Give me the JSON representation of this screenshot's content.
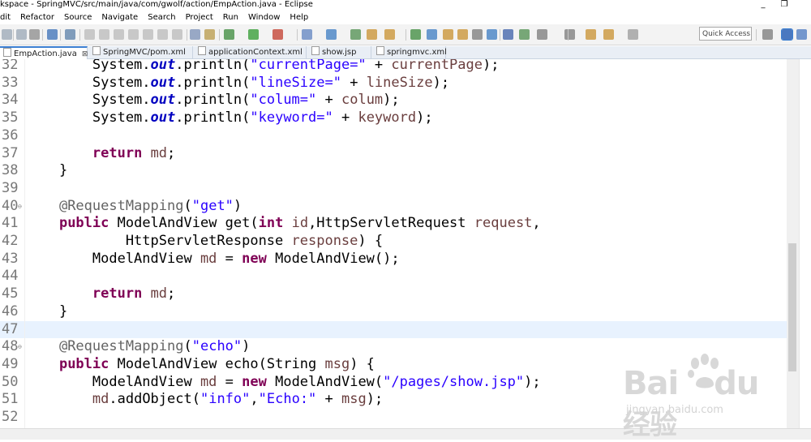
{
  "window": {
    "title": "kspace - SpringMVC/src/main/java/com/gwolf/action/EmpAction.java - Eclipse",
    "minimize": "_",
    "restore": "❐"
  },
  "menu": [
    "dit",
    "Refactor",
    "Source",
    "Navigate",
    "Search",
    "Project",
    "Run",
    "Window",
    "Help"
  ],
  "toolbar": {
    "quick_access": "Quick Access",
    "accent": "#3c7fd1"
  },
  "tabs": [
    {
      "label": "EmpAction.java",
      "active": true,
      "close": "⊠"
    },
    {
      "label": "SpringMVC/pom.xml",
      "active": false
    },
    {
      "label": "applicationContext.xml",
      "active": false
    },
    {
      "label": "show.jsp",
      "active": false
    },
    {
      "label": "springmvc.xml",
      "active": false
    }
  ],
  "editor": {
    "current_line": 47,
    "lines": [
      {
        "n": "32",
        "fold": false,
        "tokens": [
          [
            "",
            "        System."
          ],
          [
            "fld",
            "out"
          ],
          [
            "",
            ".println("
          ],
          [
            "st",
            "\"currentPage=\""
          ],
          [
            "",
            " + "
          ],
          [
            "vr",
            "currentPage"
          ],
          [
            "",
            ");"
          ]
        ]
      },
      {
        "n": "33",
        "fold": false,
        "tokens": [
          [
            "",
            "        System."
          ],
          [
            "fld",
            "out"
          ],
          [
            "",
            ".println("
          ],
          [
            "st",
            "\"lineSize=\""
          ],
          [
            "",
            " + "
          ],
          [
            "vr",
            "lineSize"
          ],
          [
            "",
            ");"
          ]
        ]
      },
      {
        "n": "34",
        "fold": false,
        "tokens": [
          [
            "",
            "        System."
          ],
          [
            "fld",
            "out"
          ],
          [
            "",
            ".println("
          ],
          [
            "st",
            "\"colum=\""
          ],
          [
            "",
            " + "
          ],
          [
            "vr",
            "colum"
          ],
          [
            "",
            ");"
          ]
        ]
      },
      {
        "n": "35",
        "fold": false,
        "tokens": [
          [
            "",
            "        System."
          ],
          [
            "fld",
            "out"
          ],
          [
            "",
            ".println("
          ],
          [
            "st",
            "\"keyword=\""
          ],
          [
            "",
            " + "
          ],
          [
            "vr",
            "keyword"
          ],
          [
            "",
            ");"
          ]
        ]
      },
      {
        "n": "36",
        "fold": false,
        "tokens": []
      },
      {
        "n": "37",
        "fold": false,
        "tokens": [
          [
            "",
            "        "
          ],
          [
            "kw",
            "return"
          ],
          [
            "",
            " "
          ],
          [
            "vr",
            "md"
          ],
          [
            "",
            ";"
          ]
        ]
      },
      {
        "n": "38",
        "fold": false,
        "tokens": [
          [
            "",
            "    }"
          ]
        ]
      },
      {
        "n": "39",
        "fold": false,
        "tokens": []
      },
      {
        "n": "40",
        "fold": true,
        "tokens": [
          [
            "",
            "    "
          ],
          [
            "an",
            "@RequestMapping"
          ],
          [
            "",
            "("
          ],
          [
            "st",
            "\"get\""
          ],
          [
            "",
            ")"
          ]
        ]
      },
      {
        "n": "41",
        "fold": false,
        "tokens": [
          [
            "",
            "    "
          ],
          [
            "kw",
            "public"
          ],
          [
            "",
            " ModelAndView get("
          ],
          [
            "kw",
            "int"
          ],
          [
            "",
            " "
          ],
          [
            "vr",
            "id"
          ],
          [
            "",
            ",HttpServletRequest "
          ],
          [
            "vr",
            "request"
          ],
          [
            "",
            ","
          ]
        ]
      },
      {
        "n": "42",
        "fold": false,
        "tokens": [
          [
            "",
            "            HttpServletResponse "
          ],
          [
            "vr",
            "response"
          ],
          [
            "",
            ") {"
          ]
        ]
      },
      {
        "n": "43",
        "fold": false,
        "tokens": [
          [
            "",
            "        ModelAndView "
          ],
          [
            "vr",
            "md"
          ],
          [
            "",
            " = "
          ],
          [
            "kw",
            "new"
          ],
          [
            "",
            " ModelAndView();"
          ]
        ]
      },
      {
        "n": "44",
        "fold": false,
        "tokens": []
      },
      {
        "n": "45",
        "fold": false,
        "tokens": [
          [
            "",
            "        "
          ],
          [
            "kw",
            "return"
          ],
          [
            "",
            " "
          ],
          [
            "vr",
            "md"
          ],
          [
            "",
            ";"
          ]
        ]
      },
      {
        "n": "46",
        "fold": false,
        "tokens": [
          [
            "",
            "    }"
          ]
        ]
      },
      {
        "n": "47",
        "fold": false,
        "tokens": []
      },
      {
        "n": "48",
        "fold": true,
        "tokens": [
          [
            "",
            "    "
          ],
          [
            "an",
            "@RequestMapping"
          ],
          [
            "",
            "("
          ],
          [
            "st",
            "\"echo\""
          ],
          [
            "",
            ")"
          ]
        ]
      },
      {
        "n": "49",
        "fold": false,
        "tokens": [
          [
            "",
            "    "
          ],
          [
            "kw",
            "public"
          ],
          [
            "",
            " ModelAndView echo(String "
          ],
          [
            "vr",
            "msg"
          ],
          [
            "",
            ") {"
          ]
        ]
      },
      {
        "n": "50",
        "fold": false,
        "tokens": [
          [
            "",
            "        ModelAndView "
          ],
          [
            "vr",
            "md"
          ],
          [
            "",
            " = "
          ],
          [
            "kw",
            "new"
          ],
          [
            "",
            " ModelAndView("
          ],
          [
            "st",
            "\"/pages/show.jsp\""
          ],
          [
            "",
            ");"
          ]
        ]
      },
      {
        "n": "51",
        "fold": false,
        "tokens": [
          [
            "",
            "        "
          ],
          [
            "vr",
            "md"
          ],
          [
            "",
            ".addObject("
          ],
          [
            "st",
            "\"info\""
          ],
          [
            "",
            ","
          ],
          [
            "st",
            "\"Echo:\""
          ],
          [
            "",
            " + "
          ],
          [
            "vr",
            "msg"
          ],
          [
            "",
            ");"
          ]
        ]
      },
      {
        "n": "52",
        "fold": false,
        "tokens": []
      }
    ]
  },
  "watermark": {
    "brand": "Bai",
    "brand_tail": "du",
    "cn": "经验",
    "site": "jingyan.baidu.com"
  }
}
